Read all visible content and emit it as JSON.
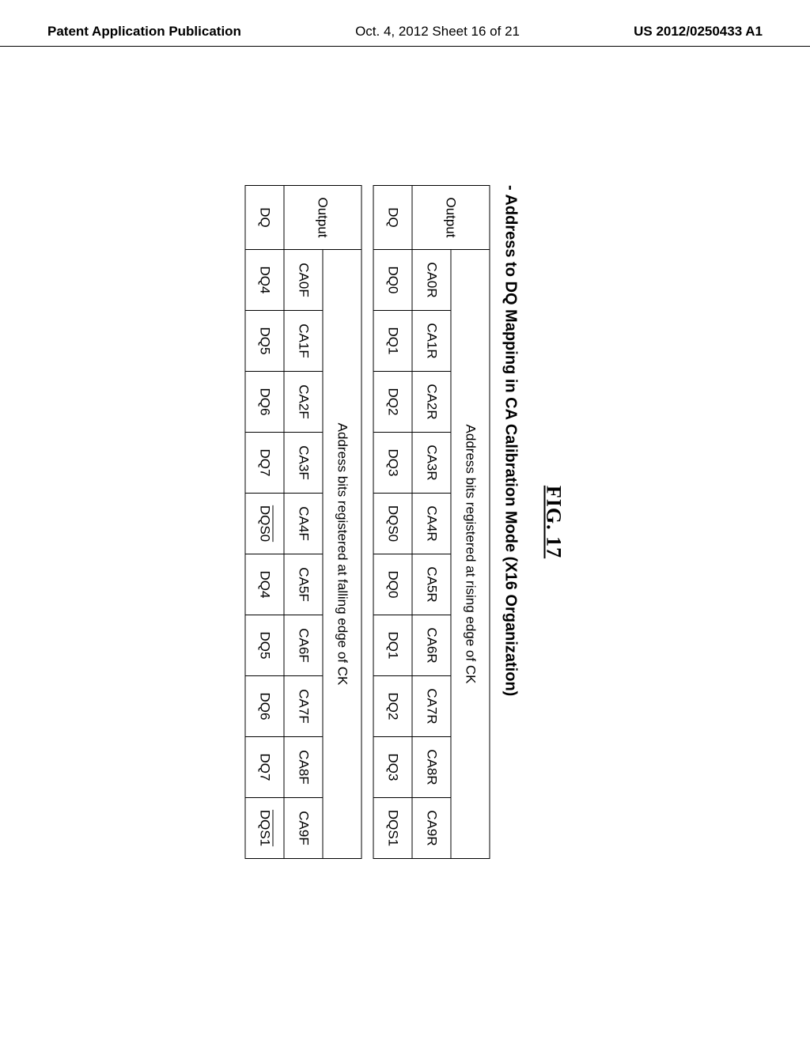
{
  "header": {
    "left": "Patent Application Publication",
    "center": "Oct. 4, 2012  Sheet 16 of 21",
    "right": "US 2012/0250433 A1"
  },
  "figure": {
    "label": "FIG.  17",
    "subtitle": "- Address to DQ Mapping in CA Calibration Mode (X16 Organization)"
  },
  "table1": {
    "outputLabel": "Output",
    "spanHeader": "Address bits registered at rising edge of CK",
    "row1": [
      "CA0R",
      "CA1R",
      "CA2R",
      "CA3R",
      "CA4R",
      "CA5R",
      "CA6R",
      "CA7R",
      "CA8R",
      "CA9R"
    ],
    "dqLabel": "DQ",
    "row2": [
      "DQ0",
      "DQ1",
      "DQ2",
      "DQ3",
      "DQS0",
      "DQ0",
      "DQ1",
      "DQ2",
      "DQ3",
      "DQS1"
    ]
  },
  "table2": {
    "outputLabel": "Output",
    "spanHeader": "Address bits registered at falling edge of CK",
    "row1": [
      "CA0F",
      "CA1F",
      "CA2F",
      "CA3F",
      "CA4F",
      "CA5F",
      "CA6F",
      "CA7F",
      "CA8F",
      "CA9F"
    ],
    "dqLabel": "DQ",
    "row2": [
      "DQ4",
      "DQ5",
      "DQ6",
      "DQ7",
      "DQS0",
      "DQ4",
      "DQ5",
      "DQ6",
      "DQ7",
      "DQS1"
    ],
    "overlineIdx": [
      4,
      9
    ]
  },
  "chart_data": {
    "type": "table",
    "title": "Address to DQ Mapping in CA Calibration Mode (X16 Organization)",
    "tables": [
      {
        "caption": "Address bits registered at rising edge of CK",
        "rows": [
          {
            "Output": "",
            "cells": [
              "CA0R",
              "CA1R",
              "CA2R",
              "CA3R",
              "CA4R",
              "CA5R",
              "CA6R",
              "CA7R",
              "CA8R",
              "CA9R"
            ]
          },
          {
            "Output": "DQ",
            "cells": [
              "DQ0",
              "DQ1",
              "DQ2",
              "DQ3",
              "DQS0",
              "DQ0",
              "DQ1",
              "DQ2",
              "DQ3",
              "DQS1"
            ]
          }
        ]
      },
      {
        "caption": "Address bits registered at falling edge of CK",
        "rows": [
          {
            "Output": "",
            "cells": [
              "CA0F",
              "CA1F",
              "CA2F",
              "CA3F",
              "CA4F",
              "CA5F",
              "CA6F",
              "CA7F",
              "CA8F",
              "CA9F"
            ]
          },
          {
            "Output": "DQ",
            "cells": [
              "DQ4",
              "DQ5",
              "DQ6",
              "DQ7",
              "DQS0 (overline)",
              "DQ4",
              "DQ5",
              "DQ6",
              "DQ7",
              "DQS1 (overline)"
            ]
          }
        ]
      }
    ]
  }
}
